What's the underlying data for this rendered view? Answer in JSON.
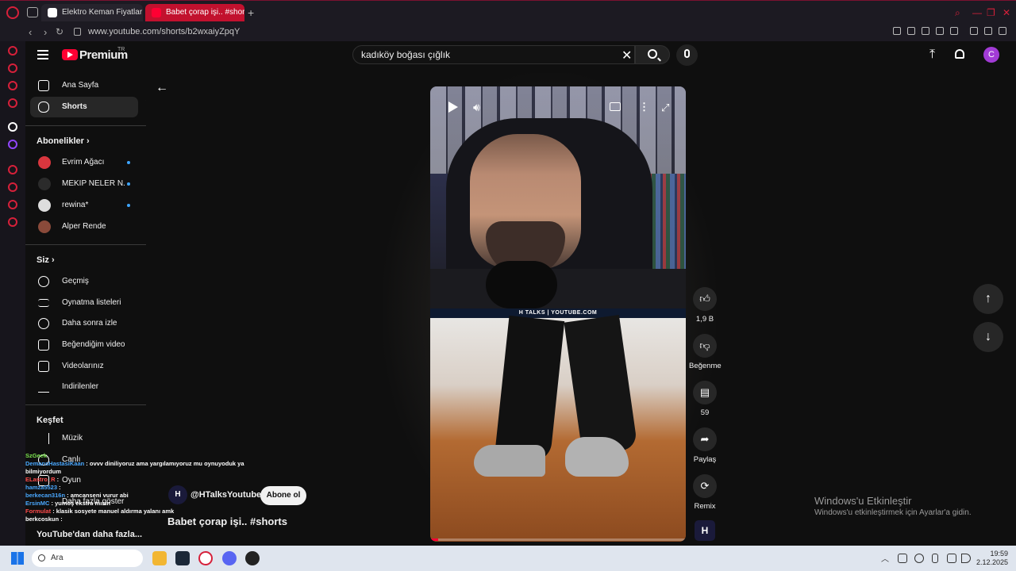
{
  "browser": {
    "tabs": [
      {
        "label": "Elektro Keman Fiyatları ve"
      },
      {
        "label": "Babet çorap işi.. #shorts"
      }
    ],
    "url": "www.youtube.com/shorts/b2wxaiyZpqY"
  },
  "header": {
    "logo_text": "Premium",
    "logo_suffix": "TR",
    "search_value": "kadıköy boğası çığlık",
    "avatar_letter": "C"
  },
  "sidebar": {
    "top_items": [
      {
        "label": "Ana Sayfa",
        "icon": "home-icon"
      },
      {
        "label": "Shorts",
        "icon": "shorts-icon"
      }
    ],
    "subscriptions_heading": "Abonelikler",
    "subscriptions": [
      {
        "label": "Evrim Ağacı"
      },
      {
        "label": "MEKİP NELER N..."
      },
      {
        "label": "rewina*"
      },
      {
        "label": "Alper Rende"
      }
    ],
    "you_heading": "Siz",
    "you_items": [
      {
        "label": "Geçmiş",
        "icon": "history-icon"
      },
      {
        "label": "Oynatma listeleri",
        "icon": "playlist-icon"
      },
      {
        "label": "Daha sonra izle",
        "icon": "clock-icon"
      },
      {
        "label": "Beğendiğim videolar",
        "icon": "like-icon"
      },
      {
        "label": "Videolarınız",
        "icon": "video-icon"
      },
      {
        "label": "İndirilenler",
        "icon": "download-icon"
      }
    ],
    "explore_heading": "Keşfet",
    "explore_items": [
      {
        "label": "Müzik",
        "icon": "music-icon"
      },
      {
        "label": "Canlı",
        "icon": "live-icon"
      },
      {
        "label": "Oyun",
        "icon": "gaming-icon"
      },
      {
        "label": "Daha fazla göster",
        "icon": "chevron-down-icon"
      }
    ],
    "more_from_youtube": "YouTube'dan daha fazla..."
  },
  "chat": [
    {
      "user": "SzGeek",
      "text": ""
    },
    {
      "user": "DemansHastasiKaan",
      "text": ": ovvv diniliyoruz ama yargılamıyoruz mu oynuyoduk ya bilmiyordum"
    },
    {
      "user": "ELastro_R",
      "text": ":"
    },
    {
      "user": "hamza5523",
      "text": ":"
    },
    {
      "user": "berkecan316n",
      "text": ": amcanseni vurur abi"
    },
    {
      "user": "ErsinMC",
      "text": ": yumoş ekstra mısın"
    },
    {
      "user": "Formulat",
      "text": ": klasik sosyete manuel aldırma yalanı amk"
    },
    {
      "user": "berkcoskun",
      "text": ":"
    }
  ],
  "short": {
    "banner_text": "H TALKS | YOUTUBE.COM",
    "channel_handle": "@HTalksYoutube",
    "channel_initial": "H",
    "subscribe_label": "Abone ol",
    "title": "Babet çorap işi.. #shorts",
    "progress": 0.03
  },
  "actions": {
    "like_count": "1,9 B",
    "dislike_label": "Beğenme",
    "comment_count": "59",
    "share_label": "Paylaş",
    "remix_label": "Remix"
  },
  "watermark": {
    "line1": "Windows'u Etkinleştir",
    "line2": "Windows'u etkinleştirmek için Ayarlar'a gidin."
  },
  "taskbar": {
    "search_label": "Ara",
    "time": "19:59",
    "date": "2.12.2025"
  },
  "colors": {
    "accent": "#ff0033",
    "opera_red": "#d6203a",
    "link_blue": "#3ea6ff"
  }
}
